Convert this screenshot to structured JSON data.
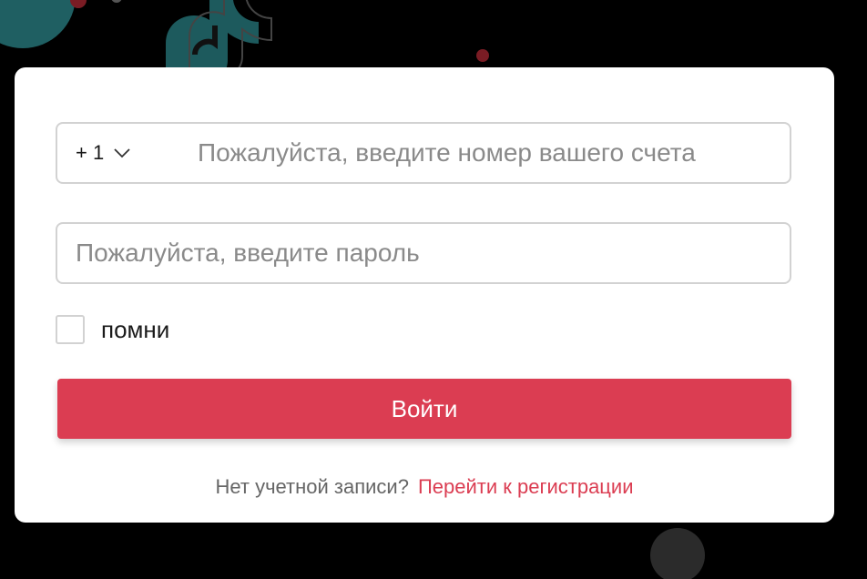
{
  "login": {
    "country_code": "+ 1",
    "phone_placeholder": "Пожалуйста, введите номер вашего счета",
    "password_placeholder": "Пожалуйста, введите пароль",
    "remember_label": "помни",
    "remember_checked": false,
    "submit_label": "Войти",
    "no_account_text": "Нет учетной записи?",
    "register_link": "Перейти к регистрации"
  },
  "colors": {
    "background": "#000000",
    "card": "#ffffff",
    "accent": "#db3d52",
    "decor_teal": "#1f5f62"
  },
  "icons": {
    "country_dropdown": "chevron-down-icon",
    "background_logo": "tiktok-logo-icon"
  }
}
